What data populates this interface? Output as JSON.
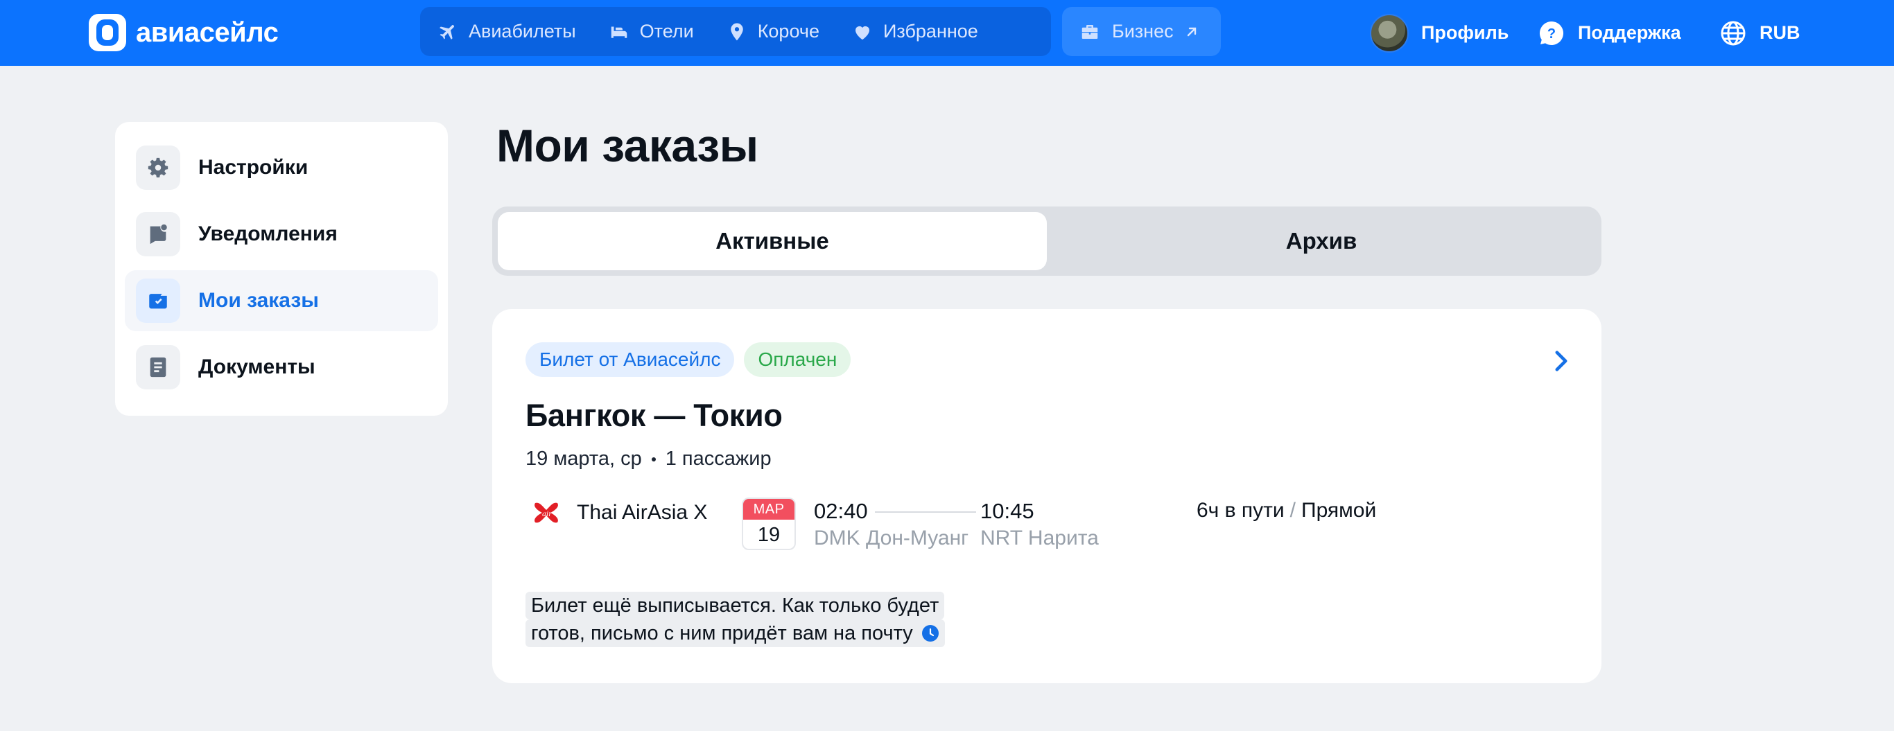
{
  "header": {
    "logo_text": "авиасейлс",
    "nav": [
      {
        "label": "Авиабилеты",
        "icon": "plane-icon"
      },
      {
        "label": "Отели",
        "icon": "bed-icon"
      },
      {
        "label": "Короче",
        "icon": "map-pin-icon"
      },
      {
        "label": "Избранное",
        "icon": "heart-icon"
      }
    ],
    "business": {
      "label": "Бизнес",
      "icon": "briefcase-icon",
      "arrow_icon": "external-arrow-icon"
    },
    "profile_label": "Профиль",
    "support_label": "Поддержка",
    "currency_label": "RUB"
  },
  "sidebar": {
    "items": [
      {
        "label": "Настройки",
        "icon": "gear-icon",
        "active": false
      },
      {
        "label": "Уведомления",
        "icon": "notification-icon",
        "active": false
      },
      {
        "label": "Мои заказы",
        "icon": "wallet-icon",
        "active": true
      },
      {
        "label": "Документы",
        "icon": "document-icon",
        "active": false
      }
    ]
  },
  "main": {
    "title": "Мои заказы",
    "tabs": [
      {
        "label": "Активные",
        "active": true
      },
      {
        "label": "Архив",
        "active": false
      }
    ],
    "order": {
      "badge_ticket": "Билет от Авиасейлс",
      "badge_status": "Оплачен",
      "route": "Бангкок — Токио",
      "date": "19 марта, ср",
      "passengers": "1 пассажир",
      "airline": "Thai AirAsia X",
      "date_chip": {
        "month": "МАР",
        "day": "19"
      },
      "departure_time": "02:40",
      "departure_airport": "DMK Дон-Муанг",
      "arrival_time": "10:45",
      "arrival_airport": "NRT Нарита",
      "duration": "6ч в пути",
      "stops": "Прямой",
      "notice_line1": "Билет ещё выписывается. Как только будет",
      "notice_line2": "готов, письмо с ним придёт вам на почту"
    }
  },
  "colors": {
    "brand_blue": "#0c73fe",
    "accent_blue": "#1570e6",
    "paid_green": "#2aa84a",
    "date_red": "#f24f5f",
    "background": "#eff1f4"
  }
}
